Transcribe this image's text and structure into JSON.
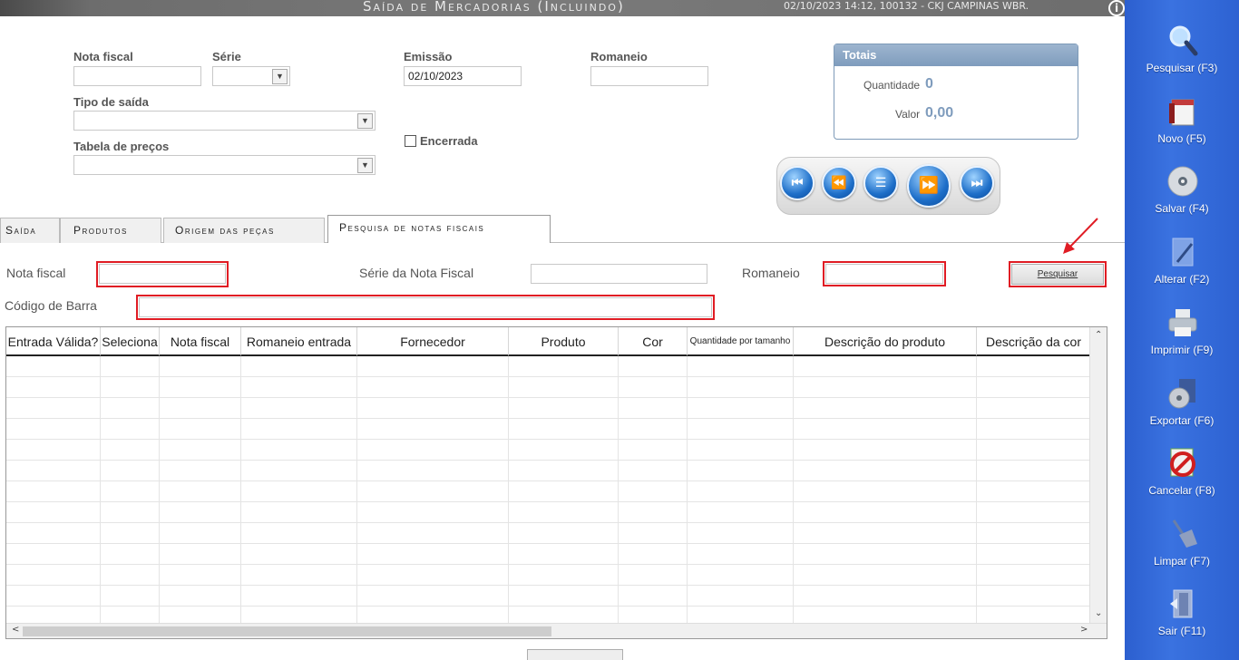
{
  "window": {
    "title": "Saída de Mercadorias (Incluindo)",
    "info": "02/10/2023 14:12, 100132 - CKJ CAMPINAS WBR."
  },
  "form": {
    "nota_fiscal_label": "Nota fiscal",
    "nota_fiscal_value": "",
    "serie_label": "Série",
    "serie_value": "",
    "emissao_label": "Emissão",
    "emissao_value": "02/10/2023",
    "romaneio_label": "Romaneio",
    "romaneio_value": "",
    "tipo_saida_label": "Tipo de saída",
    "tipo_saida_value": "",
    "tabela_precos_label": "Tabela de preços",
    "tabela_precos_value": "",
    "encerrada_label": "Encerrada",
    "encerrada_checked": false
  },
  "totals": {
    "header": "Totais",
    "quantidade_label": "Quantidade",
    "quantidade_value": "0",
    "valor_label": "Valor",
    "valor_value": "0,00"
  },
  "tabs": [
    {
      "label": "Saída",
      "active": false
    },
    {
      "label": "Produtos",
      "active": false
    },
    {
      "label": "Origem das peças",
      "active": false
    },
    {
      "label": "Pesquisa de notas fiscais",
      "active": true
    }
  ],
  "search": {
    "nota_fiscal_label": "Nota fiscal",
    "serie_nf_label": "Série da Nota Fiscal",
    "romaneio_label": "Romaneio",
    "codigo_barra_label": "Código de Barra",
    "button_label": "Pesquisar"
  },
  "grid": {
    "columns": [
      "Entrada Válida?",
      "Seleciona",
      "Nota fiscal",
      "Romaneio entrada",
      "Fornecedor",
      "Produto",
      "Cor",
      "Quantidade por tamanho",
      "Descrição do produto",
      "Descrição da cor"
    ],
    "rows": []
  },
  "sidebar": {
    "items": [
      {
        "label": "Pesquisar (F3)",
        "icon": "magnifier-icon"
      },
      {
        "label": "Novo (F5)",
        "icon": "calendar-icon"
      },
      {
        "label": "Salvar (F4)",
        "icon": "disc-icon"
      },
      {
        "label": "Alterar (F2)",
        "icon": "edit-document-icon"
      },
      {
        "label": "Imprimir (F9)",
        "icon": "printer-icon"
      },
      {
        "label": "Exportar (F6)",
        "icon": "export-disc-icon"
      },
      {
        "label": "Cancelar (F8)",
        "icon": "cancel-icon"
      },
      {
        "label": "Limpar (F7)",
        "icon": "broom-icon"
      },
      {
        "label": "Sair (F11)",
        "icon": "exit-door-icon"
      }
    ]
  },
  "colors": {
    "sidebar": "#3a72e0",
    "totals_header": "#7f9cbd",
    "highlight": "#e01c24"
  }
}
